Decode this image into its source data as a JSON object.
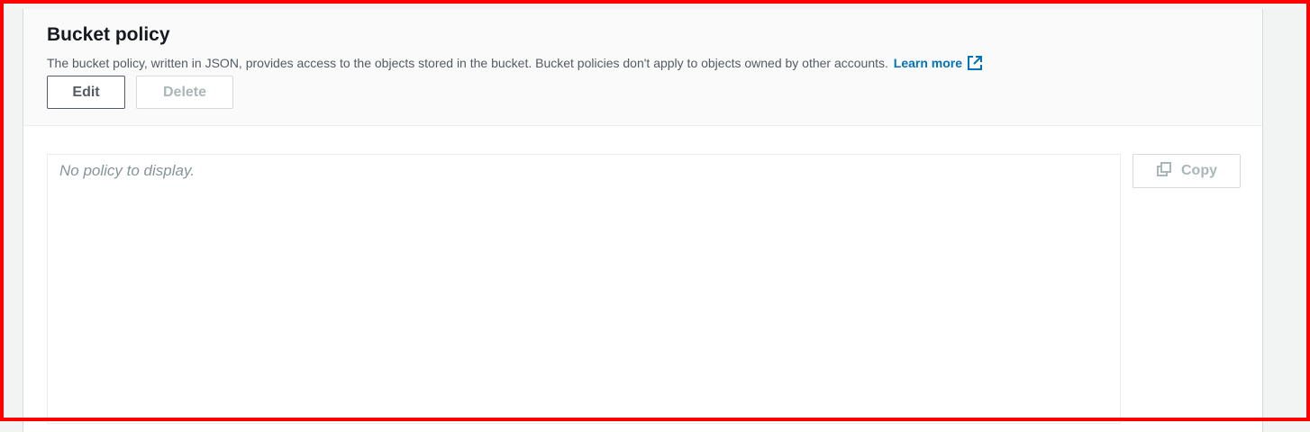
{
  "section": {
    "title": "Bucket policy",
    "description": "The bucket policy, written in JSON, provides access to the objects stored in the bucket. Bucket policies don't apply to objects owned by other accounts.",
    "learn_more_label": "Learn more",
    "learn_more_icon": "external-link-icon"
  },
  "buttons": {
    "edit_label": "Edit",
    "delete_label": "Delete",
    "copy_label": "Copy",
    "copy_icon": "copy-icon"
  },
  "policy_viewer": {
    "empty_text": "No policy to display."
  },
  "colors": {
    "link": "#0073bb",
    "disabled_text": "#aab7b8",
    "highlight_frame": "#ff0000"
  }
}
